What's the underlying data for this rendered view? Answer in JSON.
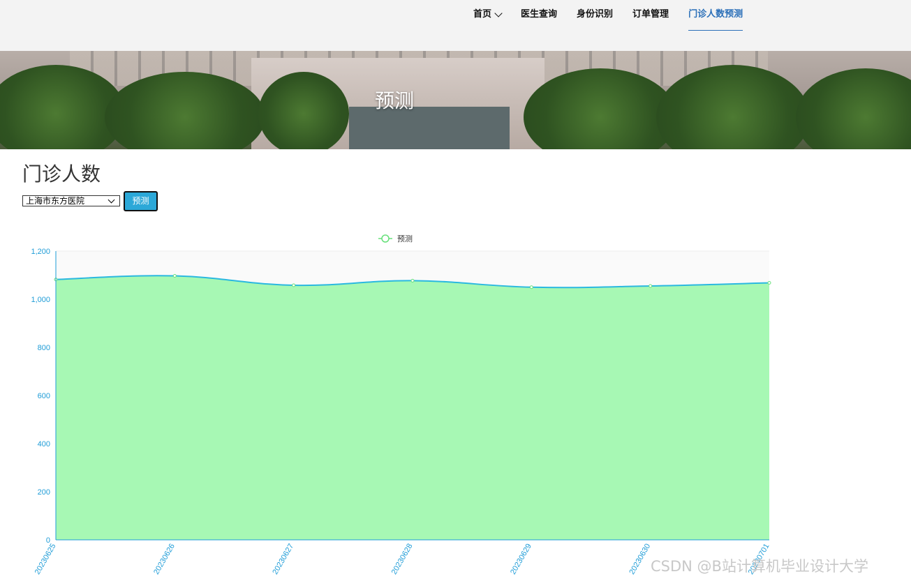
{
  "nav": {
    "items": [
      {
        "label": "首页",
        "has_dropdown": true,
        "active": false
      },
      {
        "label": "医生查询",
        "has_dropdown": false,
        "active": false
      },
      {
        "label": "身份识别",
        "has_dropdown": false,
        "active": false
      },
      {
        "label": "订单管理",
        "has_dropdown": false,
        "active": false
      },
      {
        "label": "门诊人数预测",
        "has_dropdown": false,
        "active": true
      }
    ],
    "active_color": "#2a6fb8"
  },
  "banner": {
    "title": "预测"
  },
  "main": {
    "title": "门诊人数",
    "hospital_select": {
      "value": "上海市东方医院"
    },
    "predict_button": "预测"
  },
  "chart_data": {
    "type": "area",
    "legend": [
      "预测"
    ],
    "categories": [
      "20230625",
      "20230626",
      "20230627",
      "20230628",
      "20230629",
      "20230630",
      "20230701"
    ],
    "series": [
      {
        "name": "预测",
        "values": [
          1082,
          1097,
          1058,
          1077,
          1050,
          1055,
          1068
        ],
        "color": "#66e07a",
        "line_color": "#2ab8e0",
        "fill": "#a2f8b0"
      }
    ],
    "ylim": [
      0,
      1200
    ],
    "yticks": [
      0,
      200,
      400,
      600,
      800,
      1000,
      1200
    ],
    "ytick_labels": [
      "0",
      "200",
      "400",
      "600",
      "800",
      "1,000",
      "1,200"
    ],
    "smooth": true,
    "legend_position": "top-center",
    "axis_color": "#1e9cd7"
  },
  "watermark": "CSDN @B站计算机毕业设计大学"
}
